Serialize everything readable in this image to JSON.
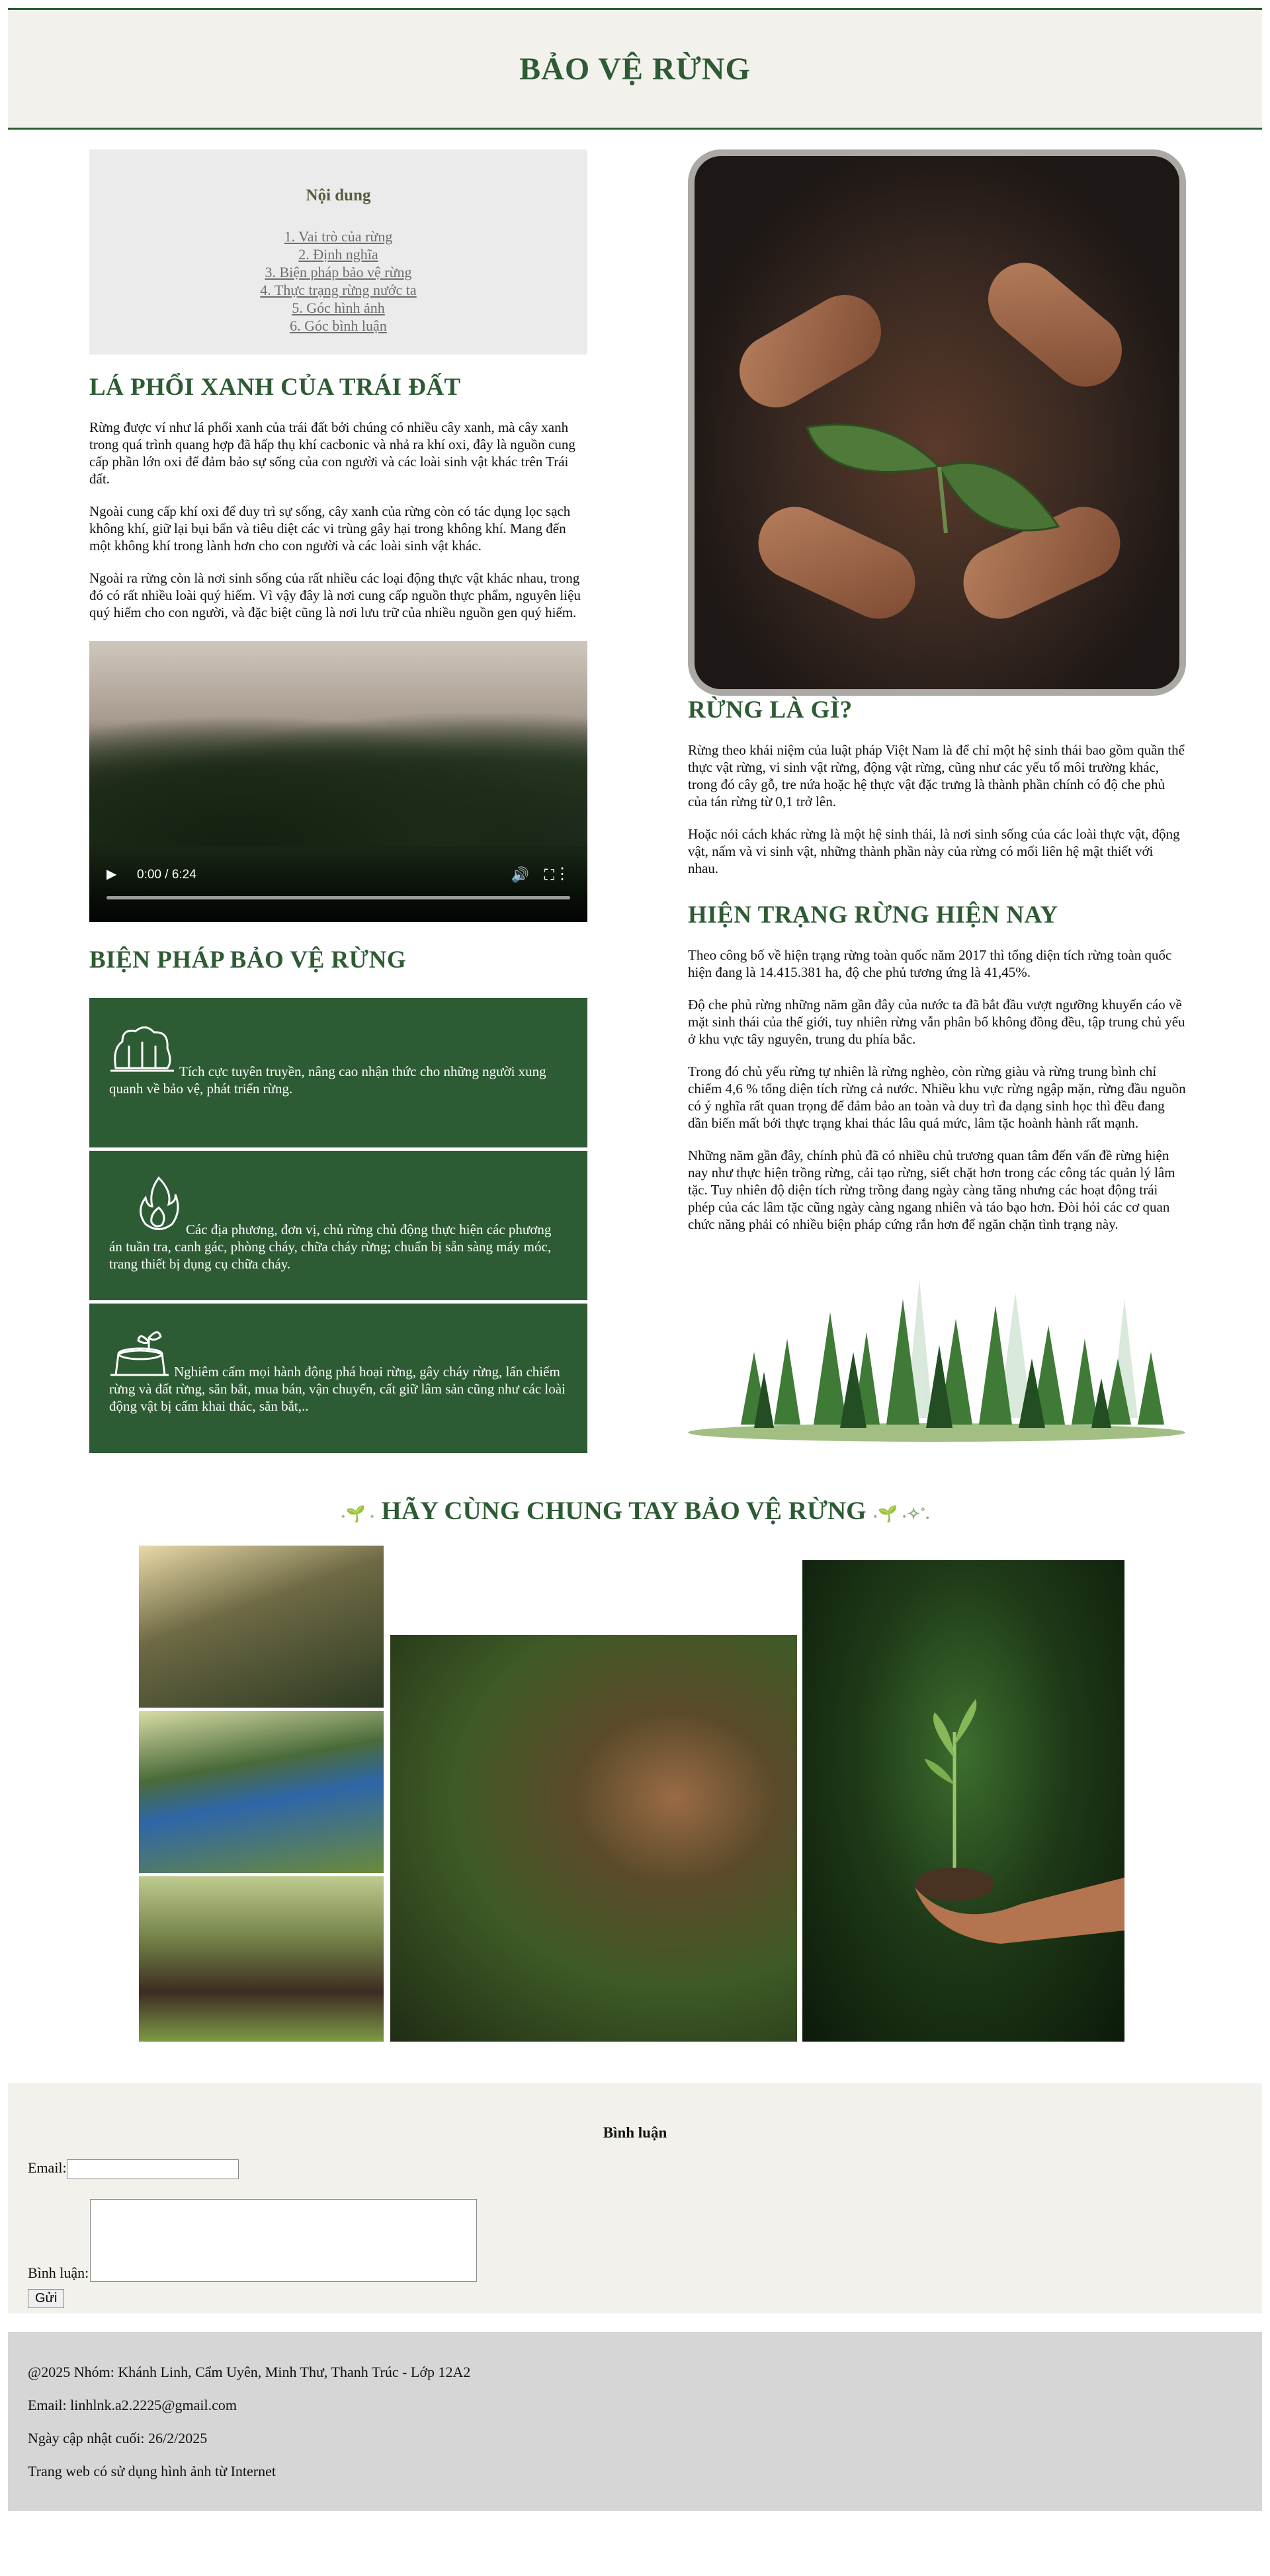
{
  "header": {
    "title": "BẢO VỆ RỪNG"
  },
  "toc": {
    "title": "Nội dung",
    "items": [
      "1. Vai trò của rừng",
      "2. Định nghĩa",
      "3. Biện pháp bảo vệ rừng",
      "4. Thực trạng rừng nước ta",
      "5. Góc hình ảnh",
      "6. Góc bình luận"
    ]
  },
  "lungs": {
    "title": "LÁ PHỔI XANH CỦA TRÁI ĐẤT",
    "paragraphs": [
      "Rừng được ví như lá phổi xanh của trái đất bởi chúng có nhiều cây xanh, mà cây xanh trong quá trình quang hợp đã hấp thụ khí cacbonic và nhả ra khí oxi, đây là nguồn cung cấp phần lớn oxi để đảm bảo sự sống của con người và các loài sinh vật khác trên Trái đất.",
      "Ngoài cung cấp khí oxi để duy trì sự sống, cây xanh của rừng còn có tác dụng lọc sạch không khí, giữ lại bụi bẩn và tiêu diệt các vi trùng gây hại trong không khí. Mang đến một không khí trong lành hơn cho con người và các loài sinh vật khác.",
      "Ngoài ra rừng còn là nơi sinh sống của rất nhiều các loại động thực vật khác nhau, trong đó có rất nhiều loài quý hiếm. Vì vậy đây là nơi cung cấp nguồn thực phẩm, nguyên liệu quý hiếm cho con người, và đặc biệt cũng là nơi lưu trữ của nhiều nguồn gen quý hiếm."
    ]
  },
  "video": {
    "time": "0:00 / 6:24"
  },
  "measures": {
    "title": "BIỆN PHÁP BẢO VỆ RỪNG",
    "cards": [
      {
        "icon": "forest-icon",
        "text": "Tích cực tuyên truyền, nâng cao nhận thức cho những người xung quanh về bảo vệ, phát triển rừng."
      },
      {
        "icon": "fire-icon",
        "text": "Các địa phương, đơn vị, chủ rừng chủ động thực hiện các phương án tuần tra, canh gác, phòng cháy, chữa cháy rừng; chuẩn bị sẵn sàng máy móc, trang thiết bị dụng cụ chữa cháy."
      },
      {
        "icon": "stump-sprout-icon",
        "text": "Nghiêm cấm mọi hành động phá hoại rừng, gây cháy rừng, lấn chiếm rừng và đất rừng, săn bắt, mua bán, vận chuyển, cất giữ lâm sản cũng như các loài động vật bị cấm khai thác, săn bắt,.."
      }
    ]
  },
  "definition": {
    "title": "RỪNG LÀ GÌ?",
    "paragraphs": [
      "Rừng theo khái niệm của luật pháp Việt Nam là để chỉ một hệ sinh thái bao gồm quần thể thực vật rừng, vi sinh vật rừng, động vật rừng, cũng như các yếu tố môi trường khác, trong đó cây gỗ, tre nứa hoặc hệ thực vật đặc trưng là thành phần chính có độ che phủ của tán rừng từ 0,1 trở lên.",
      "Hoặc nói cách khác rừng là một hệ sinh thái, là nơi sinh sống của các loài thực vật, động vật, nấm và vi sinh vật, những thành phần này của rừng có mối liên hệ mật thiết với nhau."
    ]
  },
  "status": {
    "title": "HIỆN TRẠNG RỪNG HIỆN NAY",
    "paragraphs": [
      "Theo công bố về hiện trạng rừng toàn quốc năm 2017 thì tổng diện tích rừng toàn quốc hiện đang là 14.415.381 ha, độ che phủ tương ứng là 41,45%.",
      "Độ che phủ rừng những năm gần đây của nước ta đã bắt đầu vượt ngưỡng khuyến cáo về mặt sinh thái của thế giới, tuy nhiên rừng vẫn phân bố không đồng đều, tập trung chủ yếu ở khu vực tây nguyên, trung du phía bắc.",
      "Trong đó chủ yếu rừng tự nhiên là rừng nghèo, còn rừng giàu và rừng trung bình chỉ chiếm 4,6 % tổng diện tích rừng cả nước. Nhiều khu vực rừng ngập mặn, rừng đầu nguồn có ý nghĩa rất quan trọng để đảm bảo an toàn và duy trì đa dạng sinh học thì đều đang dần biến mất bởi thực trạng khai thác lâu quá mức, lâm tặc hoành hành rất mạnh.",
      "Những năm gần đây, chính phủ đã có nhiều chủ trương quan tâm đến vấn đề rừng hiện nay như thực hiện trồng rừng, cải tạo rừng, siết chặt hơn trong các công tác quản lý lâm tặc. Tuy nhiên độ diện tích rừng trồng đang ngày càng tăng nhưng các hoạt động trái phép của các lâm tặc cũng ngày càng ngang nhiên và táo bạo hơn. Đòi hỏi các cơ quan chức năng phải có nhiều biện pháp cứng rắn hơn để ngăn chặn tình trạng này."
    ]
  },
  "slogan": {
    "left": "˖🌱 ˖",
    "text": "HÃY CÙNG CHUNG TAY BẢO VỆ RỪNG",
    "right": "˖🌱 ˖✧˚."
  },
  "comments": {
    "title": "Bình luận",
    "email_label": "Email:",
    "comment_label": "Bình luận:",
    "send_label": "Gửi"
  },
  "footer": {
    "credits": "@2025 Nhóm: Khánh Linh, Cẩm Uyên, Minh Thư, Thanh Trúc - Lớp 12A2",
    "email": "Email: linhlnk.a2.2225@gmail.com",
    "updated": "Ngày cập nhật cuối: 26/2/2025",
    "note": "Trang web có sử dụng hình ảnh từ Internet"
  },
  "colors": {
    "accent": "#2d5b33",
    "header_bg": "#f2f1ec",
    "toc_bg": "#ebebeb",
    "footer_bg": "#d6d6d6"
  }
}
